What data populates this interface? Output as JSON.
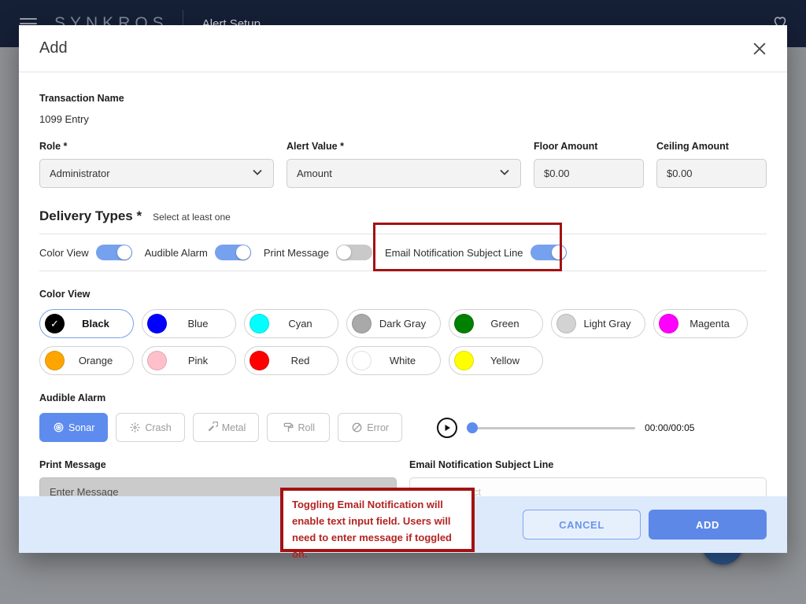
{
  "topbar": {
    "brand": "SYNKROS",
    "page_title": "Alert Setup"
  },
  "modal": {
    "title": "Add",
    "transaction": {
      "label": "Transaction Name",
      "value": "1099 Entry"
    },
    "fields": {
      "role": {
        "label": "Role *",
        "value": "Administrator"
      },
      "alert_value": {
        "label": "Alert Value *",
        "value": "Amount"
      },
      "floor": {
        "label": "Floor Amount",
        "value": "$0.00"
      },
      "ceiling": {
        "label": "Ceiling Amount",
        "value": "$0.00"
      }
    },
    "delivery": {
      "heading": "Delivery Types *",
      "note": "Select at least one",
      "toggles": [
        {
          "label": "Color View",
          "on": true
        },
        {
          "label": "Audible Alarm",
          "on": true
        },
        {
          "label": "Print Message",
          "on": false
        },
        {
          "label": "Email Notification Subject Line",
          "on": true,
          "annotated": true
        }
      ]
    },
    "color_view": {
      "label": "Color View",
      "options": [
        {
          "label": "Black",
          "color": "#000000",
          "selected": true
        },
        {
          "label": "Blue",
          "color": "#0000ff"
        },
        {
          "label": "Cyan",
          "color": "#00ffff"
        },
        {
          "label": "Dark Gray",
          "color": "#a9a9a9"
        },
        {
          "label": "Green",
          "color": "#008000"
        },
        {
          "label": "Light Gray",
          "color": "#d3d3d3"
        },
        {
          "label": "Magenta",
          "color": "#ff00ff"
        },
        {
          "label": "Orange",
          "color": "#ffa500"
        },
        {
          "label": "Pink",
          "color": "#ffc0cb"
        },
        {
          "label": "Red",
          "color": "#ff0000"
        },
        {
          "label": "White",
          "color": "#ffffff"
        },
        {
          "label": "Yellow",
          "color": "#ffff00"
        }
      ]
    },
    "audible": {
      "label": "Audible Alarm",
      "options": [
        {
          "label": "Sonar",
          "icon": "sonar-icon",
          "selected": true
        },
        {
          "label": "Crash",
          "icon": "crash-icon"
        },
        {
          "label": "Metal",
          "icon": "wrench-icon"
        },
        {
          "label": "Roll",
          "icon": "roller-icon"
        },
        {
          "label": "Error",
          "icon": "error-icon"
        }
      ],
      "player": {
        "time": "00:00/00:05"
      }
    },
    "print_message": {
      "label": "Print Message",
      "placeholder": "Enter Message"
    },
    "email_subject": {
      "label": "Email Notification Subject Line",
      "placeholder": "Enter Subject"
    },
    "footer": {
      "cancel": "CANCEL",
      "add": "ADD"
    }
  },
  "annotation": {
    "note": "Toggling Email Notification will enable text input field. Users will need to enter message if toggled on.",
    "colors": {
      "border": "#a31212",
      "text": "#b32421"
    }
  },
  "colors": {
    "accent_blue": "#5d88e8",
    "toggle_on": "#76a1ee",
    "footer_bg": "#ddeafc",
    "topbar_navy": "#151f36",
    "backdrop_gray": "#8f9296"
  }
}
